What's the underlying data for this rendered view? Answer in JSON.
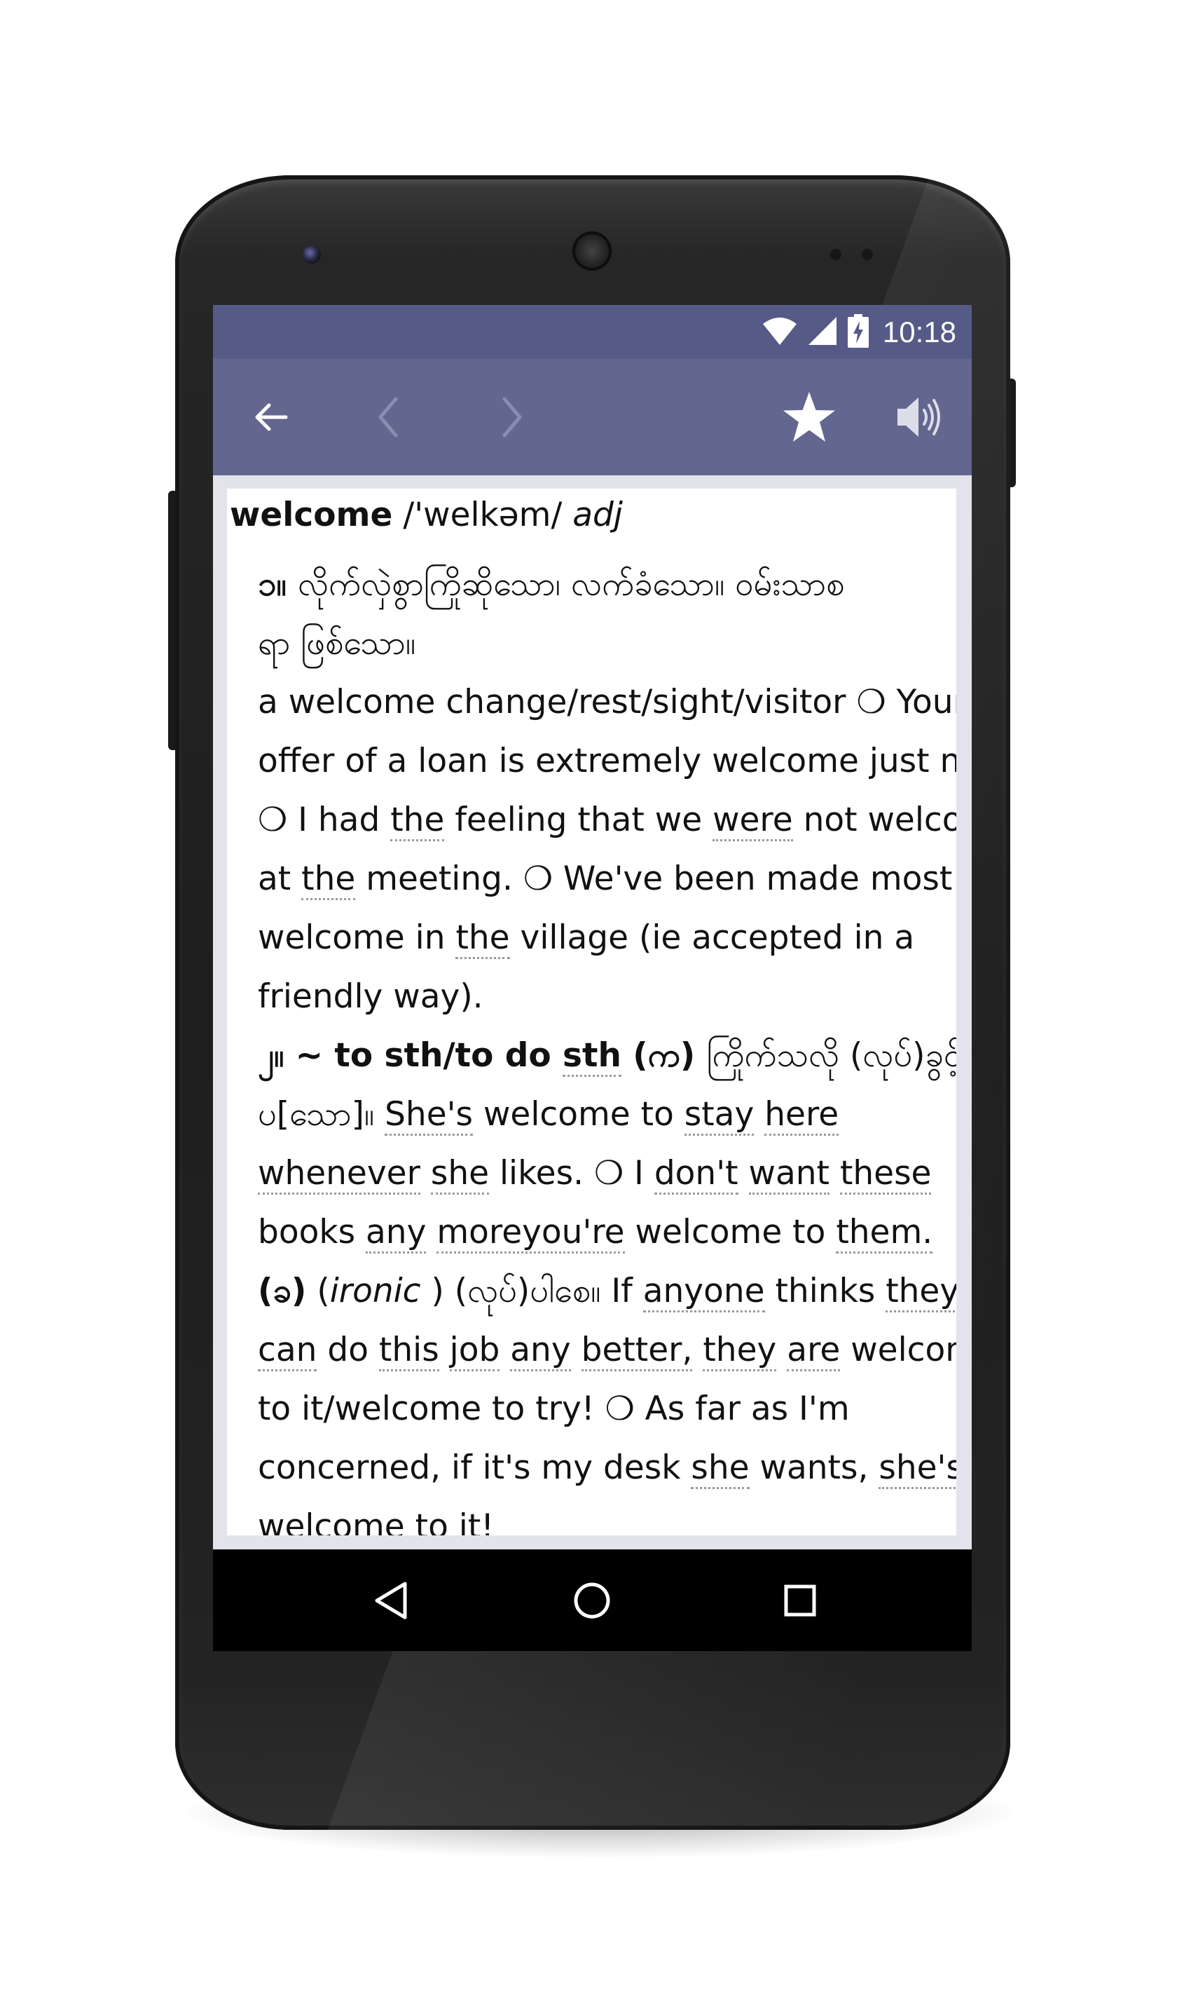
{
  "status_bar": {
    "time": "10:18",
    "icons": [
      "wifi-icon",
      "signal-icon",
      "battery-charging-icon"
    ]
  },
  "toolbar": {
    "icons": [
      "back-arrow-icon",
      "previous-icon",
      "next-icon",
      "star-icon",
      "speaker-icon"
    ]
  },
  "entry": {
    "headword": "welcome",
    "pronunciation": "/'welkəm/",
    "part_of_speech": "adj",
    "lines": [
      [
        {
          "t": "၁။ ",
          "b": true
        },
        {
          "t": "လိုက်လှဲစွာကြိုဆိုသော၊ လက်ခံသော။ ဝမ်းသာစ"
        }
      ],
      [
        {
          "t": "ရာ ဖြစ်သော။"
        }
      ],
      [
        {
          "t": "a welcome change/rest/sight/visitor ❍ Your"
        }
      ],
      [
        {
          "t": "offer of a loan is extremely welcome just now."
        }
      ],
      [
        {
          "t": "❍ I had "
        },
        {
          "t": "the",
          "u": true
        },
        {
          "t": " feeling that we "
        },
        {
          "t": "were",
          "u": true
        },
        {
          "t": " not welcome"
        }
      ],
      [
        {
          "t": "at "
        },
        {
          "t": "the",
          "u": true
        },
        {
          "t": " meeting. ❍ We've been made most"
        }
      ],
      [
        {
          "t": "welcome in "
        },
        {
          "t": "the",
          "u": true
        },
        {
          "t": " village (ie accepted in a"
        }
      ],
      [
        {
          "t": "friendly way)."
        }
      ],
      [
        {
          "t": "၂။ ~ to sth/to do ",
          "b": true
        },
        {
          "t": "sth",
          "b": true,
          "u": true
        },
        {
          "t": " (က) ",
          "b": true
        },
        {
          "t": "ကြိုက်သလို (လုပ်)ခွင့်["
        }
      ],
      [
        {
          "t": "ပ[သော]။ "
        },
        {
          "t": "She's",
          "u": true
        },
        {
          "t": " welcome to "
        },
        {
          "t": "stay",
          "u": true
        },
        {
          "t": " "
        },
        {
          "t": "here",
          "u": true
        }
      ],
      [
        {
          "t": "whenever",
          "u": true
        },
        {
          "t": " "
        },
        {
          "t": "she",
          "u": true
        },
        {
          "t": " likes. ❍ I "
        },
        {
          "t": "don't",
          "u": true
        },
        {
          "t": " "
        },
        {
          "t": "want",
          "u": true
        },
        {
          "t": " "
        },
        {
          "t": "these",
          "u": true
        }
      ],
      [
        {
          "t": "books "
        },
        {
          "t": "any",
          "u": true
        },
        {
          "t": " "
        },
        {
          "t": "moreyou're",
          "u": true
        },
        {
          "t": " welcome to "
        },
        {
          "t": "them.",
          "u": true
        }
      ],
      [
        {
          "t": "(ခ)",
          "b": true
        },
        {
          "t": " ("
        },
        {
          "t": "ironic",
          "i": true
        },
        {
          "t": " ) (လုပ်)ပါစေ။ If "
        },
        {
          "t": "anyone",
          "u": true
        },
        {
          "t": " thinks "
        },
        {
          "t": "they",
          "u": true
        }
      ],
      [
        {
          "t": "can",
          "u": true
        },
        {
          "t": " do "
        },
        {
          "t": "this",
          "u": true
        },
        {
          "t": " "
        },
        {
          "t": "job",
          "u": true
        },
        {
          "t": " "
        },
        {
          "t": "any",
          "u": true
        },
        {
          "t": " "
        },
        {
          "t": "better,",
          "u": true
        },
        {
          "t": " "
        },
        {
          "t": "they",
          "u": true
        },
        {
          "t": " "
        },
        {
          "t": "are",
          "u": true
        },
        {
          "t": " welcome"
        }
      ],
      [
        {
          "t": "to it/welcome to try! ❍ As far as I'm"
        }
      ],
      [
        {
          "t": "concerned, if it's my desk "
        },
        {
          "t": "she",
          "u": true
        },
        {
          "t": " wants, "
        },
        {
          "t": "she's",
          "u": true
        }
      ],
      [
        {
          "t": "welcome to it!"
        }
      ]
    ]
  },
  "nav_bar": {
    "icons": [
      "nav-back-icon",
      "nav-home-icon",
      "nav-recents-icon"
    ]
  },
  "colors": {
    "status_bar": "#565a86",
    "toolbar": "#63678f",
    "content_frame": "#e3e3ec",
    "nav_bar": "#000000"
  }
}
